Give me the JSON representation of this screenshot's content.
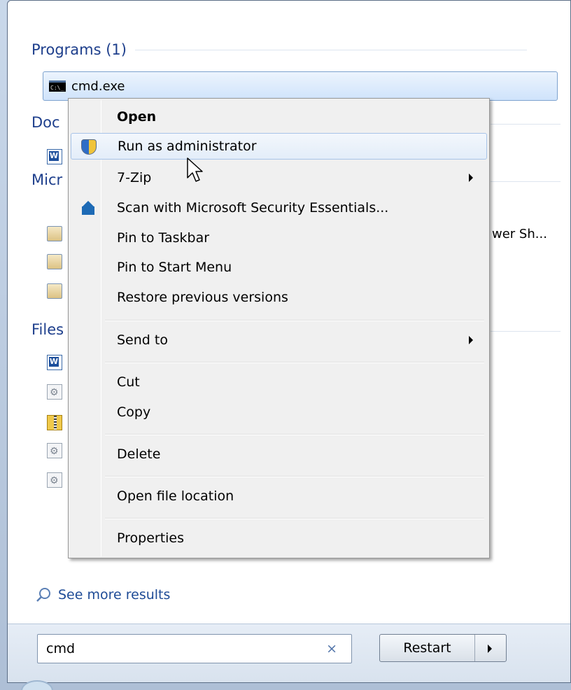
{
  "groups": {
    "programs": "Programs (1)",
    "documents_partial": "Doc",
    "microsoft_partial": "Micr",
    "files_partial": "Files"
  },
  "selected_result": {
    "label": "cmd.exe",
    "icon": "cmd-icon"
  },
  "partial_result_text": "wer Sh...",
  "context_menu": {
    "items": [
      {
        "label": "Open",
        "bold": true
      },
      {
        "label": "Run as administrator",
        "icon": "uac-shield-icon"
      },
      {
        "label": "7-Zip",
        "submenu": true
      },
      {
        "label": "Scan with Microsoft Security Essentials...",
        "icon": "security-essentials-icon"
      },
      {
        "label": "Pin to Taskbar"
      },
      {
        "label": "Pin to Start Menu"
      },
      {
        "label": "Restore previous versions"
      },
      {
        "label": "Send to",
        "submenu": true
      },
      {
        "label": "Cut"
      },
      {
        "label": "Copy"
      },
      {
        "label": "Delete"
      },
      {
        "label": "Open file location"
      },
      {
        "label": "Properties"
      }
    ]
  },
  "see_more": "See more results",
  "search": {
    "value": "cmd",
    "clear_glyph": "×"
  },
  "restart": {
    "label": "Restart"
  }
}
